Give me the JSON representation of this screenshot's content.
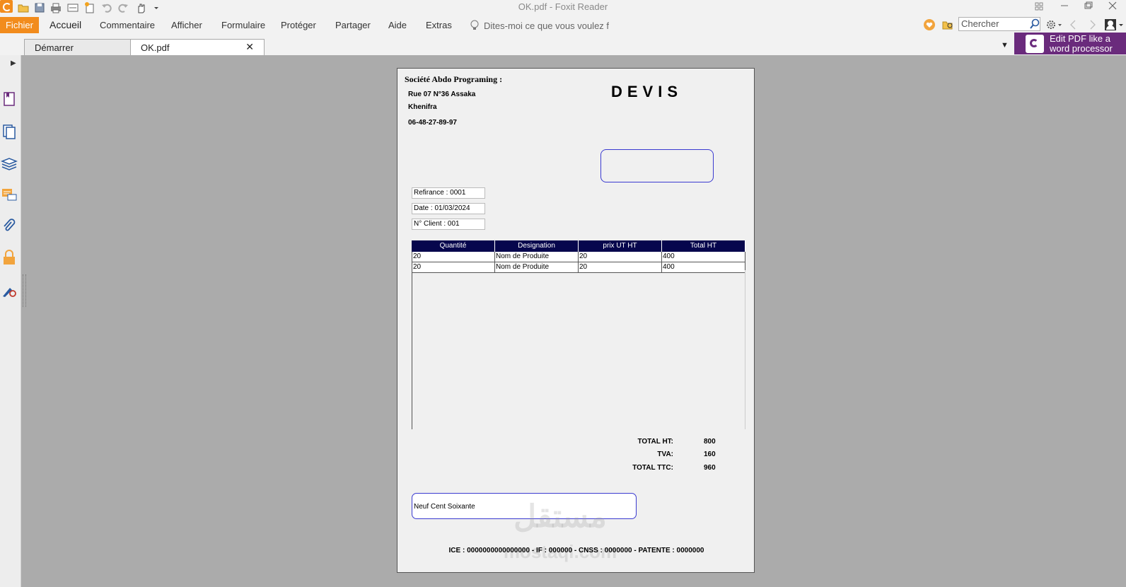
{
  "window": {
    "title": "OK.pdf - Foxit Reader"
  },
  "menu": {
    "file": "Fichier",
    "items": [
      "Accueil",
      "Commentaire",
      "Afficher",
      "Formulaire",
      "Protéger",
      "Partager",
      "Aide",
      "Extras"
    ],
    "tell_me": "Dites-moi ce que vous voulez f",
    "search_placeholder": "Chercher"
  },
  "tabs": {
    "start": "Démarrer",
    "document": "OK.pdf",
    "close": "✕"
  },
  "promo": {
    "line1": "Edit PDF like a",
    "line2": "word processor",
    "icon_label": "PDF"
  },
  "icons": {
    "quick_access": [
      "foxit-logo-icon",
      "open-icon",
      "save-icon",
      "print-icon",
      "scan-icon",
      "new-icon",
      "undo-icon",
      "redo-icon",
      "hand-tool-icon",
      "customize-icon"
    ],
    "left_nav": [
      "bookmark-icon",
      "pages-icon",
      "layers-icon",
      "comments-icon",
      "attachments-icon",
      "security-icon",
      "signature-icon"
    ]
  },
  "colors": {
    "accent": "#f28c1d",
    "promo": "#6a2b7c",
    "table_header": "#06064d",
    "box_border": "#3a3ad0"
  },
  "document": {
    "company": "Société Abdo Programing :",
    "address1": "Rue 07 N°36 Assaka",
    "address2": "Khenifra",
    "phone": "06-48-27-89-97",
    "title": "DEVIS",
    "reference": "Refirance : 0001",
    "date": "Date : 01/03/2024",
    "client_no": "N° Client : 001",
    "table": {
      "headers": [
        "Quantité",
        "Designation",
        "prix UT HT",
        "Total HT"
      ],
      "rows": [
        [
          "20",
          "Nom de Produite",
          "20",
          "400"
        ],
        [
          "20",
          "Nom de Produite",
          "20",
          "400"
        ]
      ]
    },
    "totals": {
      "ht_label": "TOTAL HT:",
      "ht_value": "800",
      "tva_label": "TVA:",
      "tva_value": "160",
      "ttc_label": "TOTAL TTC:",
      "ttc_value": "960"
    },
    "amount_words": "Neuf Cent Soixante",
    "watermark": "مستقل",
    "watermark_latin": "mostaqi.com",
    "footer": "ICE : 0000000000000000 - IF : 000000 - CNSS : 0000000 - PATENTE : 0000000"
  }
}
